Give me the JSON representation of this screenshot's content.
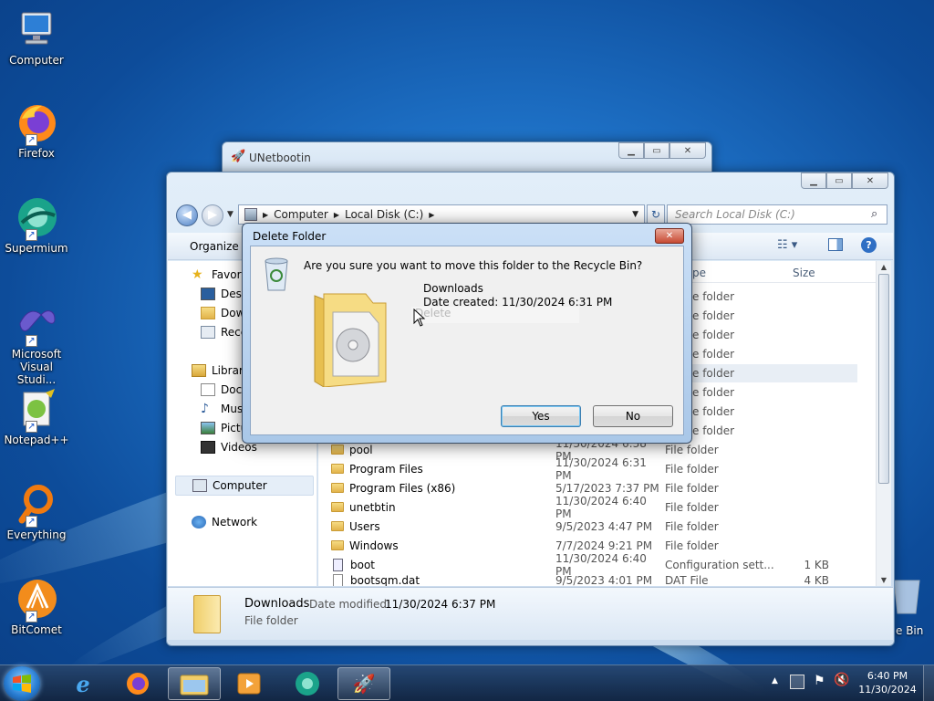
{
  "desktop": {
    "icons": [
      {
        "label": "Computer",
        "name": "computer"
      },
      {
        "label": "Firefox",
        "name": "firefox"
      },
      {
        "label": "Supermium",
        "name": "supermium"
      },
      {
        "label": "Microsoft Visual Studi...",
        "name": "visual-studio"
      },
      {
        "label": "Notepad++",
        "name": "notepad-plus-plus"
      },
      {
        "label": "Everything",
        "name": "everything"
      },
      {
        "label": "BitComet",
        "name": "bitcomet"
      }
    ],
    "recycle_bin_label": "e Bin"
  },
  "unetbootin": {
    "title": "UNetbootin"
  },
  "explorer": {
    "breadcrumb": [
      "Computer",
      "Local Disk (C:)"
    ],
    "search_placeholder": "Search Local Disk (C:)",
    "organize_label": "Organize",
    "columns": {
      "type": "pe",
      "size": "Size"
    },
    "nav": {
      "favorites": "Favori",
      "desktop": "Desk",
      "downloads": "Dow",
      "recent": "Rece",
      "libraries": "Librari",
      "documents": "Doc",
      "music": "Mus",
      "pictures": "Pictu",
      "videos": "Videos",
      "computer": "Computer",
      "network": "Network"
    },
    "hidden_types": [
      "e folder",
      "e folder",
      "e folder",
      "e folder",
      "e folder",
      "e folder",
      "e folder",
      "e folder"
    ],
    "files": [
      {
        "name": "pool",
        "date": "11/30/2024 6:38 PM",
        "type": "File folder",
        "size": "",
        "kind": "folder"
      },
      {
        "name": "Program Files",
        "date": "11/30/2024 6:31 PM",
        "type": "File folder",
        "size": "",
        "kind": "folder"
      },
      {
        "name": "Program Files (x86)",
        "date": "5/17/2023 7:37 PM",
        "type": "File folder",
        "size": "",
        "kind": "folder"
      },
      {
        "name": "unetbtin",
        "date": "11/30/2024 6:40 PM",
        "type": "File folder",
        "size": "",
        "kind": "folder"
      },
      {
        "name": "Users",
        "date": "9/5/2023 4:47 PM",
        "type": "File folder",
        "size": "",
        "kind": "folder"
      },
      {
        "name": "Windows",
        "date": "7/7/2024 9:21 PM",
        "type": "File folder",
        "size": "",
        "kind": "folder"
      },
      {
        "name": "boot",
        "date": "11/30/2024 6:40 PM",
        "type": "Configuration sett...",
        "size": "1 KB",
        "kind": "config"
      },
      {
        "name": "bootsqm.dat",
        "date": "9/5/2023 4:01 PM",
        "type": "DAT File",
        "size": "4 KB",
        "kind": "file"
      }
    ],
    "details": {
      "name": "Downloads",
      "modified_label": "Date modified:",
      "modified_value": "11/30/2024 6:37 PM",
      "type": "File folder"
    }
  },
  "dialog": {
    "title": "Delete Folder",
    "question": "Are you sure you want to move this folder to the Recycle Bin?",
    "item_name": "Downloads",
    "item_date": "Date created: 11/30/2024 6:31 PM",
    "drag_ghost_text": "Delete",
    "yes_label": "Yes",
    "no_label": "No"
  },
  "taskbar": {
    "time": "6:40 PM",
    "date": "11/30/2024",
    "items": [
      "start-orb",
      "internet-explorer",
      "firefox",
      "windows-explorer",
      "media-player",
      "supermium",
      "unetbootin"
    ]
  },
  "colors": {
    "accent": "#1d6fc4",
    "close_red": "#c74a33"
  }
}
